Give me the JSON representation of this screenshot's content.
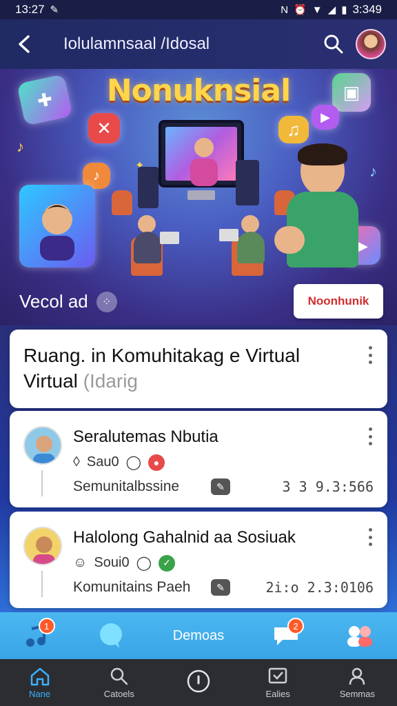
{
  "status_bar": {
    "time": "13:27",
    "right_time": "3:349"
  },
  "header": {
    "title": "Iolulamnsaal /Idosal"
  },
  "hero": {
    "banner_title": "Nonuknsial",
    "video_label": "Vecol ad",
    "badge_button": "Noonhunik"
  },
  "main_card": {
    "title": "Ruang. in Komuhitakag e Virtual",
    "subtitle": "Virtual",
    "subtitle_muted": "(Idarig"
  },
  "posts": [
    {
      "name": "Seralutemas Nbutia",
      "meta_text": "Sau0",
      "community": "Semunitalbssine",
      "stat": "3 3 9.3:566"
    },
    {
      "name": "Halolong Gahalnid aa Sosiuak",
      "meta_text": "Soui0",
      "community": "Komunitains Paeh",
      "stat": "2i:o 2.3:0106"
    }
  ],
  "tabbar": {
    "center_label": "Demoas",
    "badge_left": "1",
    "badge_right": "2"
  },
  "bottom_nav": [
    {
      "label": "Nane"
    },
    {
      "label": "Catoels"
    },
    {
      "label": ""
    },
    {
      "label": "Ealies"
    },
    {
      "label": "Semmas"
    }
  ],
  "colors": {
    "accent": "#3ab0ff",
    "reaction_red": "#e84a4a",
    "reaction_green": "#3aa34a"
  }
}
